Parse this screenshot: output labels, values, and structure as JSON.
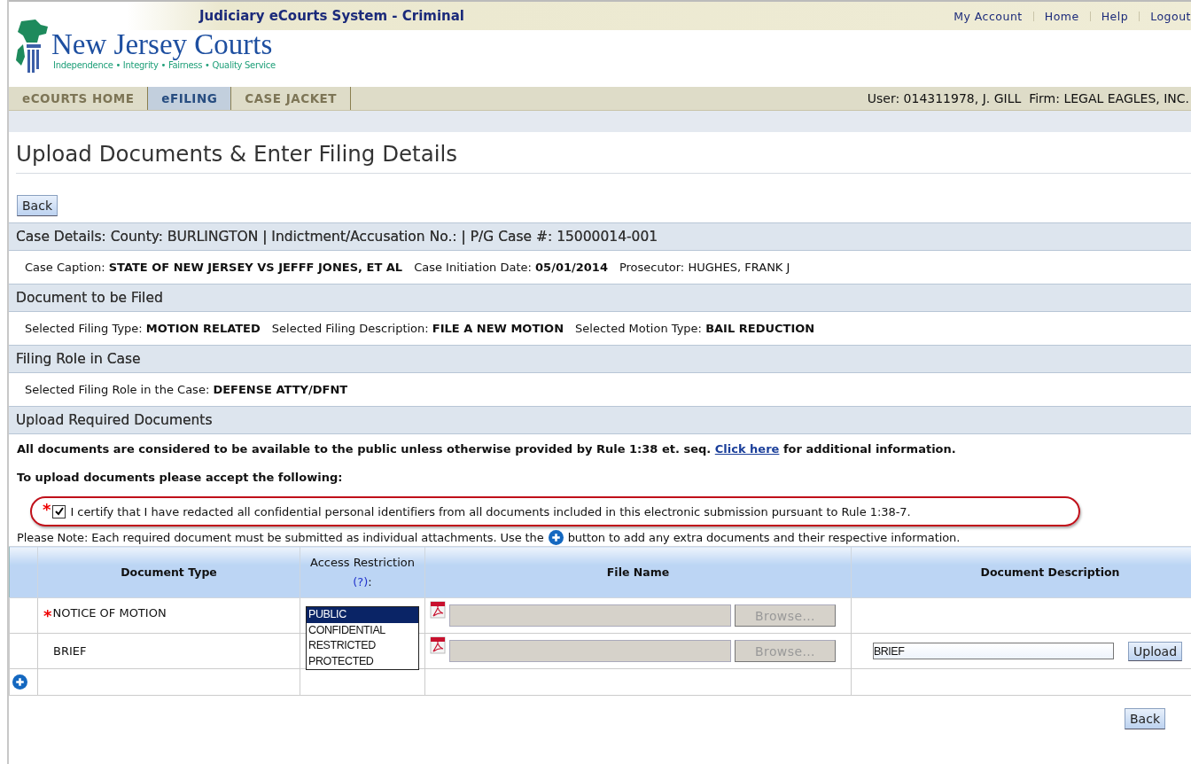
{
  "header": {
    "system_title": "Judiciary eCourts System - Criminal",
    "links": [
      "My Account",
      "Home",
      "Help",
      "Logout"
    ],
    "logo_name": "New Jersey Courts",
    "logo_tagline": "Independence • Integrity • Fairness • Quality Service"
  },
  "tabs": [
    {
      "label": "eCOURTS HOME",
      "selected": false
    },
    {
      "label": "eFILING",
      "selected": true
    },
    {
      "label": "CASE JACKET",
      "selected": false
    }
  ],
  "user_info": "User: 014311978, J. GILL  Firm: LEGAL EAGLES, INC.",
  "page_title": "Upload Documents & Enter Filing Details",
  "back_button": "Back",
  "sections": [
    {
      "heading": "Case Details: County: BURLINGTON | Indictment/Accusation No.:  | P/G Case #: 15000014-001",
      "fields": [
        "Case Caption: **STATE OF NEW JERSEY VS JEFFF JONES, ET AL**",
        "Case Initiation Date: **05/01/2014**",
        "Prosecutor: HUGHES, FRANK J"
      ]
    },
    {
      "heading": "Document to be Filed",
      "fields": [
        "Selected Filing Type: **MOTION RELATED**",
        "Selected Filing Description: **FILE A NEW MOTION**",
        "Selected Motion Type: **BAIL REDUCTION**"
      ]
    },
    {
      "heading": "Filing Role in Case",
      "fields": [
        "Selected Filing Role in the Case: **DEFENSE ATTY/DFNT**"
      ]
    },
    {
      "heading": "Upload Required Documents"
    }
  ],
  "notice": {
    "before": "All documents are considered to be available to the public unless otherwise provided by Rule 1:38 et. seq.",
    "link": "Click here",
    "after": "for additional information."
  },
  "accept_prompt": "To upload documents please accept the following:",
  "certify": {
    "checked": true,
    "required_mark": "*",
    "text": "I certify that I have redacted all confidential personal identifiers from all documents included in this electronic submission pursuant to Rule 1:38-7."
  },
  "please_note": {
    "before": "Please Note: Each required document must be submitted as individual attachments. Use the",
    "after": "button to add any extra documents and their respective information."
  },
  "table": {
    "columns": [
      "Document Type",
      "Access Restriction (?):",
      "File Name",
      "Document Description"
    ],
    "rows": [
      {
        "document_type": "NOTICE OF MOTION",
        "required_mark": "*",
        "browse": "Browse...",
        "access_options": [
          {
            "label": "PUBLIC",
            "selected": true
          },
          {
            "label": "CONFIDENTIAL",
            "selected": false
          },
          {
            "label": "RESTRICTED",
            "selected": false
          },
          {
            "label": "PROTECTED",
            "selected": false
          }
        ]
      },
      {
        "document_type": "BRIEF",
        "browse": "Browse...",
        "description": "BRIEF",
        "upload": "Upload"
      }
    ]
  },
  "bottom_back_button": "Back"
}
